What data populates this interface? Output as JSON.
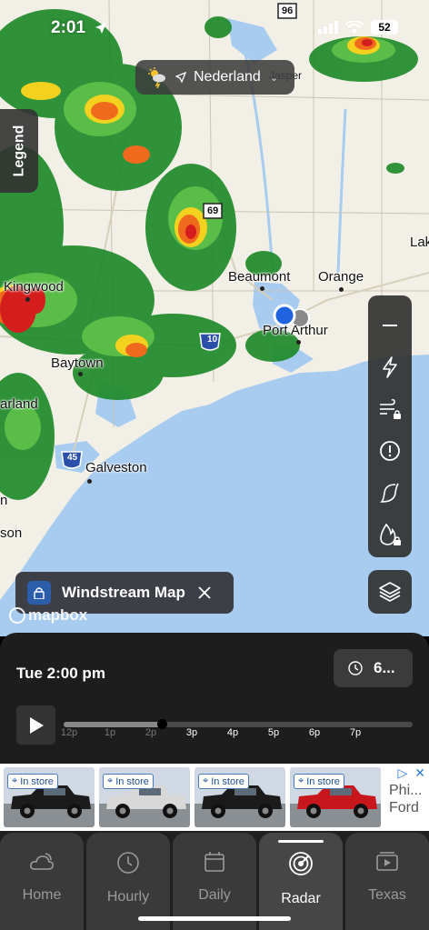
{
  "status_bar": {
    "time": "2:01",
    "battery": "52"
  },
  "location": {
    "name": "Nederland",
    "chevron": "⌄"
  },
  "legend": {
    "label": "Legend"
  },
  "map": {
    "labels": {
      "kingwood": "Kingwood",
      "baytown": "Baytown",
      "galveston": "Galveston",
      "beaumont": "Beaumont",
      "orange": "Orange",
      "port_arthur": "Port Arthur",
      "lake": "Lak",
      "arland": "arland",
      "son": "son",
      "n": "n",
      "jasper": "Jasper"
    },
    "shields": {
      "i10": "10",
      "i45": "45",
      "us69": "69",
      "us96": "96"
    }
  },
  "windstream": {
    "title": "Windstream Map"
  },
  "attribution": {
    "text": "mapbox"
  },
  "timeline": {
    "date_time": "Tue 2:00 pm",
    "duration_button": "6...",
    "progress": 0.28,
    "ticks": [
      "12p",
      "1p",
      "2p",
      "3p",
      "4p",
      "5p",
      "6p",
      "7p"
    ]
  },
  "ad": {
    "badge": "In store",
    "text_line1": "Phi...",
    "text_line2": "Ford",
    "car_colors": [
      "#1b1b1b",
      "#d8d8d8",
      "#1b1b1b",
      "#c8171c"
    ]
  },
  "nav": {
    "items": [
      {
        "label": "Home",
        "icon": "cloud-sun-icon"
      },
      {
        "label": "Hourly",
        "icon": "clock-icon"
      },
      {
        "label": "Daily",
        "icon": "calendar-icon"
      },
      {
        "label": "Radar",
        "icon": "radar-icon"
      },
      {
        "label": "Texas",
        "icon": "video-icon"
      }
    ],
    "active": "Radar"
  },
  "colors": {
    "water": "#a8ccf0",
    "land": "#f2f0e6",
    "radar_green": "#1f8a2a",
    "radar_light_green": "#5ec24a",
    "radar_yellow": "#f2d21e",
    "radar_orange": "#ef6a1c",
    "radar_red": "#d41e1e",
    "accent_blue": "#2b5dab"
  }
}
